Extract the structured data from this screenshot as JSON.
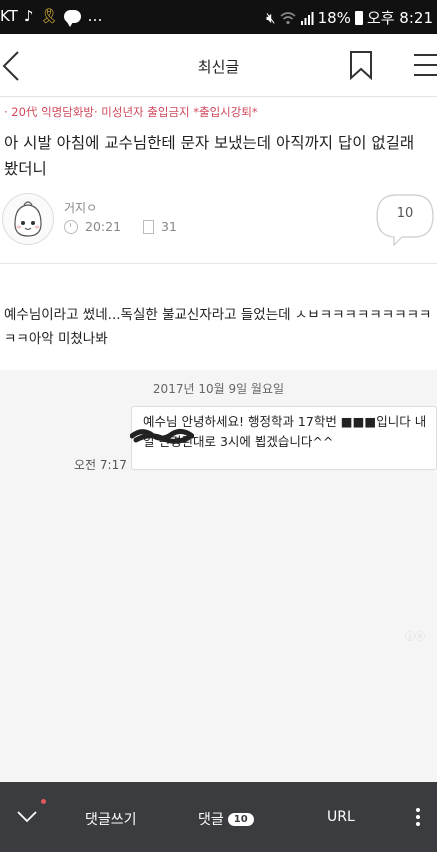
{
  "status_bar": {
    "carrier": "KT",
    "battery": "18%",
    "time": "오후 8:21",
    "icons": [
      "music-note-icon",
      "ribbon-icon",
      "talk-icon",
      "more-icon",
      "mute-icon",
      "wifi-icon",
      "signal-icon",
      "battery-icon"
    ]
  },
  "header": {
    "title": "최신글"
  },
  "post": {
    "category": "· 20代 익명담화방· 미성년자 출입금지 *출입시강퇴*",
    "title": "아 시발 아침에 교수님한테 문자 보냈는데 아직까지 답이 없길래 봤더니",
    "author": "거지ㅇ",
    "time": "20:21",
    "views": "31",
    "comment_count": "10",
    "body": "예수님이라고 썼네...독실한 불교신자라고 들었는데 ㅅㅂㅋㅋㅋㅋㅋㅋㅋㅋㅋㅋㅋ아악 미쳤나봐"
  },
  "screenshot": {
    "date": "2017년 10월 9일 월요일",
    "time": "오전 7:17",
    "message": "예수님 안녕하세요! 행정학과 17학번 ■■■입니다 내일 변경된대로 3시에 뵙겠습니다^^",
    "watermark": "ⓙⓗ"
  },
  "bottom_bar": {
    "write_comment": "댓글쓰기",
    "comments": "댓글",
    "comments_badge": "10",
    "url": "URL"
  },
  "colors": {
    "category": "#d0495c",
    "bottom_bar_bg": "#3b3c40",
    "status_bar_bg": "#111111"
  }
}
